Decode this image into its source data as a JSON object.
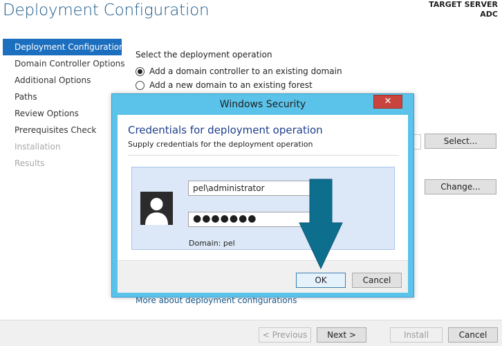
{
  "window": {
    "title": "Deployment Configuration",
    "target_server_label": "TARGET SERVER",
    "target_server_name": "ADC"
  },
  "sidebar": {
    "items": [
      {
        "label": "Deployment Configuration",
        "state": "active"
      },
      {
        "label": "Domain Controller Options",
        "state": "normal"
      },
      {
        "label": "Additional Options",
        "state": "normal"
      },
      {
        "label": "Paths",
        "state": "normal"
      },
      {
        "label": "Review Options",
        "state": "normal"
      },
      {
        "label": "Prerequisites Check",
        "state": "normal"
      },
      {
        "label": "Installation",
        "state": "disabled"
      },
      {
        "label": "Results",
        "state": "disabled"
      }
    ]
  },
  "main": {
    "operation_label": "Select the deployment operation",
    "options": [
      {
        "label": "Add a domain controller to an existing domain",
        "checked": true
      },
      {
        "label": "Add a new domain to an existing forest",
        "checked": false
      }
    ],
    "select_button": "Select...",
    "change_button": "Change...",
    "more_link": "More about deployment configurations"
  },
  "footer": {
    "previous": "< Previous",
    "next": "Next >",
    "install": "Install",
    "cancel": "Cancel"
  },
  "dialog": {
    "title": "Windows Security",
    "close_glyph": "✕",
    "heading": "Credentials for deployment operation",
    "subheading": "Supply credentials for the deployment operation",
    "username": "pel\\administrator",
    "password_mask": "●●●●●●●",
    "domain_label": "Domain: pel",
    "ok": "OK",
    "cancel": "Cancel"
  },
  "colors": {
    "accent": "#1c6fbf",
    "dialog_frame": "#5bc3ea",
    "annotation_arrow": "#0e6e8e"
  },
  "icons": {
    "avatar": "user-silhouette-icon",
    "close": "close-icon",
    "arrow": "down-arrow-annotation"
  }
}
